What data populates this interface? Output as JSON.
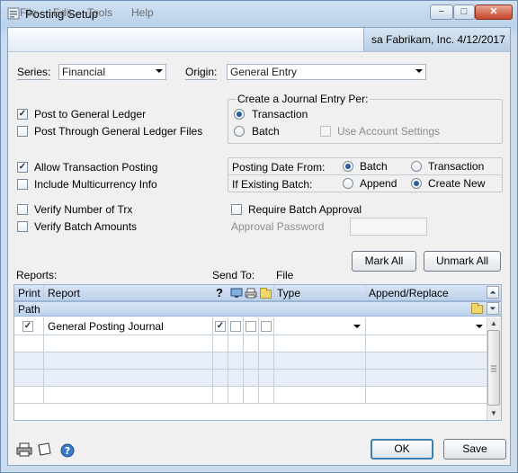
{
  "window": {
    "title": "Posting Setup",
    "minimize_glyph": "−",
    "maximize_glyph": "□",
    "close_glyph": "✕"
  },
  "menu": {
    "items": [
      "File",
      "Edit",
      "Tools",
      "Help"
    ]
  },
  "user_info": "sa  Fabrikam, Inc.  4/12/2017",
  "series": {
    "label": "Series:",
    "value": "Financial"
  },
  "origin": {
    "label": "Origin:",
    "value": "General Entry"
  },
  "post_to_gl": {
    "label": "Post to General Ledger",
    "checked": true
  },
  "post_through_gl": {
    "label": "Post Through General Ledger Files",
    "checked": false
  },
  "journal_entry": {
    "label": "Create a Journal Entry Per:",
    "transaction_label": "Transaction",
    "batch_label": "Batch",
    "use_account_settings_label": "Use Account Settings",
    "selected": "Transaction"
  },
  "allow_transaction_posting": {
    "label": "Allow Transaction Posting",
    "checked": true
  },
  "include_multicurrency": {
    "label": "Include Multicurrency Info",
    "checked": false
  },
  "posting_date_from": {
    "label": "Posting Date From:",
    "batch_label": "Batch",
    "transaction_label": "Transaction",
    "selected": "Batch"
  },
  "if_existing_batch": {
    "label": "If Existing Batch:",
    "append_label": "Append",
    "create_new_label": "Create New",
    "selected": "Create New"
  },
  "verify_number_trx": {
    "label": "Verify Number of Trx",
    "checked": false
  },
  "verify_batch_amounts": {
    "label": "Verify Batch Amounts",
    "checked": false
  },
  "require_batch_approval": {
    "label": "Require Batch Approval",
    "checked": false
  },
  "approval_password": {
    "label": "Approval Password",
    "value": ""
  },
  "buttons": {
    "mark_all": "Mark All",
    "unmark_all": "Unmark All",
    "ok": "OK",
    "save": "Save"
  },
  "reports": {
    "label": "Reports:",
    "send_to_label": "Send To:",
    "file_label": "File",
    "headers": {
      "print": "Print",
      "report": "Report",
      "help": "?",
      "type": "Type",
      "append_replace": "Append/Replace",
      "path": "Path"
    },
    "rows": [
      {
        "print": true,
        "name": "General Posting Journal",
        "screen": true,
        "printer": false,
        "file": false,
        "email": false,
        "type": "",
        "append_replace": ""
      }
    ]
  },
  "icons": {
    "title": "window-app-icon",
    "printer": "printer-icon",
    "note": "note-icon",
    "help": "help-icon",
    "folder": "folder-icon"
  },
  "colors": {
    "header_gradient_top": "#d8e5f5",
    "ok_border": "#3c7fb1",
    "close_red": "#c6452a"
  }
}
